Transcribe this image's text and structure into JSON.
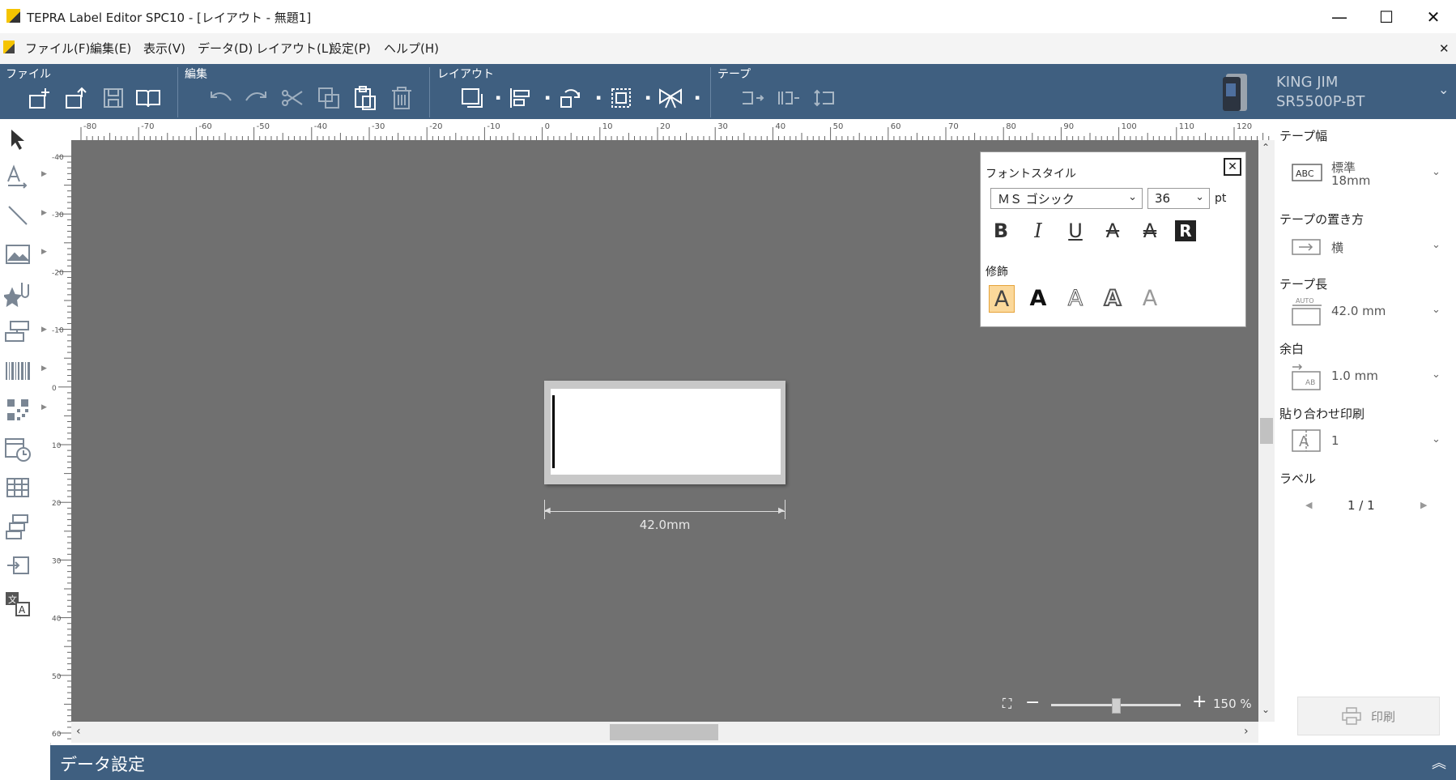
{
  "window": {
    "title": "TEPRA Label Editor SPC10 - [レイアウト - 無題1]",
    "minimize": "—",
    "maximize": "☐",
    "close": "✕"
  },
  "menu": {
    "items": [
      "ファイル(F)",
      "編集(E)",
      "表示(V)",
      "データ(D)",
      "レイアウト(L)",
      "設定(P)",
      "ヘルプ(H)"
    ],
    "close_doc": "✕"
  },
  "toolbar": {
    "groups": [
      "ファイル",
      "編集",
      "レイアウト",
      "テープ"
    ],
    "device_brand": "KING JIM",
    "device_model": "SR5500P-BT"
  },
  "ruler": {
    "top_ticks": [
      "-80",
      "-70",
      "-60",
      "-50",
      "-40",
      "-30",
      "-20",
      "-10",
      "0",
      "10",
      "20",
      "30",
      "40",
      "50",
      "60",
      "70",
      "80",
      "90",
      "100",
      "110",
      "120"
    ],
    "left_ticks": [
      "-40",
      "-30",
      "-20",
      "-10",
      "0",
      "10",
      "20",
      "30",
      "40",
      "50",
      "60"
    ]
  },
  "label": {
    "length_text": "42.0mm"
  },
  "font_panel": {
    "title": "フォントスタイル",
    "font_name": "ＭＳ ゴシック",
    "font_size": "36",
    "unit": "pt",
    "style_buttons": [
      "B",
      "I",
      "U",
      "A",
      "A",
      "R"
    ],
    "decoration_title": "修飾",
    "decorations": [
      "A",
      "A",
      "A",
      "A",
      "A"
    ]
  },
  "zoom": {
    "level": "150 %",
    "fraction": 0.5
  },
  "right_panel": {
    "tape_width_label": "テープ幅",
    "tape_width_type": "標準",
    "tape_width_value": "18mm",
    "tape_orientation_label": "テープの置き方",
    "tape_orientation_value": "横",
    "tape_length_label": "テープ長",
    "tape_length_value": "42.0 mm",
    "margin_label": "余白",
    "margin_value": "1.0 mm",
    "joint_print_label": "貼り合わせ印刷",
    "joint_print_value": "1",
    "label_label": "ラベル",
    "label_page": "1 / 1",
    "print_button": "印刷"
  },
  "bottom": {
    "data_settings": "データ設定"
  }
}
